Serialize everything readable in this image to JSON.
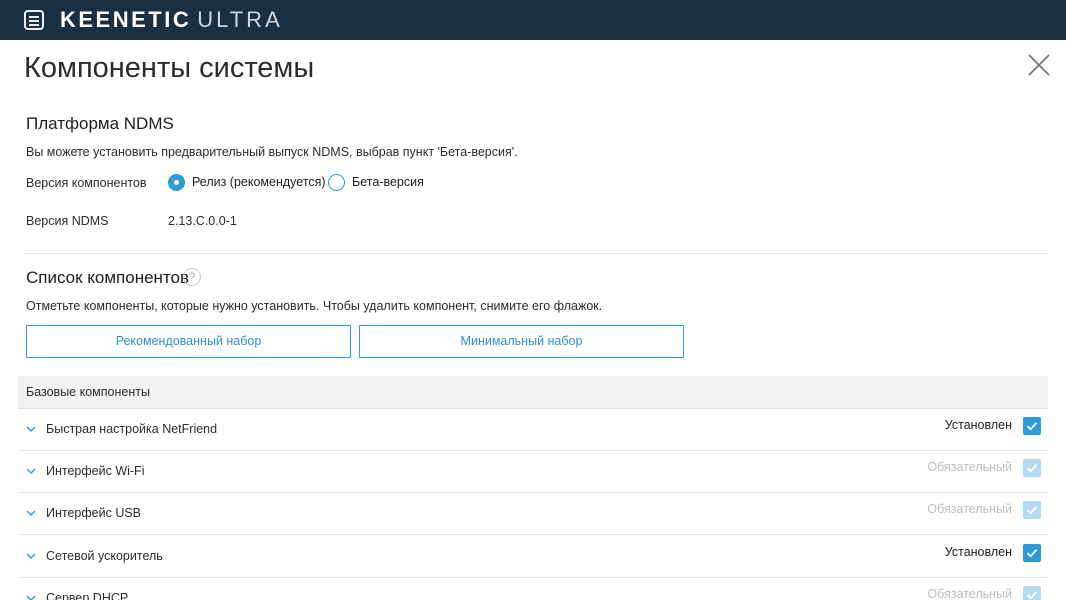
{
  "header": {
    "brand_main": "KEENETIC",
    "brand_model": "ULTRA",
    "bg_color": "#192f42"
  },
  "page": {
    "title": "Компоненты системы"
  },
  "platform": {
    "title": "Платформа NDMS",
    "description": "Вы можете установить предварительный выпуск NDMS, выбрав пункт 'Бета-версия'.",
    "version_label": "Версия компонентов",
    "options": [
      {
        "label": "Релиз (рекомендуется)",
        "selected": true
      },
      {
        "label": "Бета-версия",
        "selected": false
      }
    ],
    "ndms_label": "Версия NDMS",
    "ndms_value": "2.13.C.0.0-1"
  },
  "components": {
    "title": "Список компонентов",
    "help_glyph": "?",
    "description": "Отметьте компоненты, которые нужно установить. Чтобы удалить компонент, снимите его флажок.",
    "buttons": {
      "recommended": "Рекомендованный набор",
      "minimal": "Минимальный набор"
    },
    "group_title": "Базовые компоненты",
    "items": [
      {
        "name": "Быстрая настройка NetFriend",
        "status": "Установлен",
        "checked": true,
        "required": false
      },
      {
        "name": "Интерфейс Wi-Fi",
        "status": "Обязательный",
        "checked": true,
        "required": true
      },
      {
        "name": "Интерфейс USB",
        "status": "Обязательный",
        "checked": true,
        "required": true
      },
      {
        "name": "Сетевой ускоритель",
        "status": "Установлен",
        "checked": true,
        "required": false
      },
      {
        "name": "Сервер DHCP",
        "status": "Обязательный",
        "checked": true,
        "required": true
      }
    ]
  },
  "colors": {
    "accent": "#2f9ad9",
    "accent_disabled": "#b3daf2",
    "muted_text": "#b8bec3"
  },
  "icons": {
    "menu": "hamburger-menu-icon",
    "close": "close-icon",
    "help": "help-icon",
    "expand": "chevron-down-icon",
    "check": "checkmark-icon"
  }
}
